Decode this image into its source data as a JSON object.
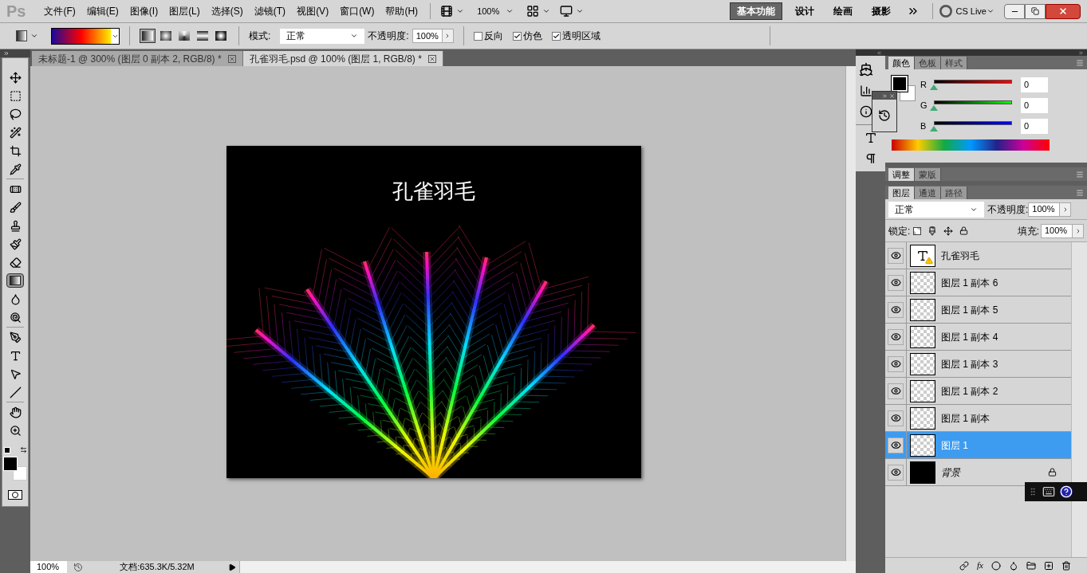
{
  "app_logo": "Ps",
  "menu": [
    "文件(F)",
    "编辑(E)",
    "图像(I)",
    "图层(L)",
    "选择(S)",
    "滤镜(T)",
    "视图(V)",
    "窗口(W)",
    "帮助(H)"
  ],
  "zoom_menu": "100%",
  "workspaces": [
    {
      "label": "基本功能",
      "selected": true
    },
    {
      "label": "设计",
      "selected": false
    },
    {
      "label": "绘画",
      "selected": false
    },
    {
      "label": "摄影",
      "selected": false
    }
  ],
  "cs_live": "CS Live",
  "options_bar": {
    "gradient_types": [
      {
        "kind": "linear",
        "selected": true
      },
      {
        "kind": "radial",
        "selected": false
      },
      {
        "kind": "angle",
        "selected": false
      },
      {
        "kind": "reflected",
        "selected": false
      },
      {
        "kind": "diamond",
        "selected": false
      }
    ],
    "mode_label": "模式:",
    "mode": "正常",
    "opacity_label": "不透明度:",
    "opacity": "100%",
    "checkboxes": [
      {
        "label": "反向",
        "checked": false
      },
      {
        "label": "仿色",
        "checked": true
      },
      {
        "label": "透明区域",
        "checked": true
      }
    ]
  },
  "document_tabs": [
    {
      "title": "未标题-1 @ 300% (图层 0 副本 2, RGB/8) *",
      "selected": false
    },
    {
      "title": "孔雀羽毛.psd @ 100% (图层 1, RGB/8) *",
      "selected": true
    }
  ],
  "tool_groups": [
    [
      {
        "kind": "move",
        "selected": false
      },
      {
        "kind": "marquee",
        "selected": false
      },
      {
        "kind": "lasso",
        "selected": false
      },
      {
        "kind": "quick-select",
        "selected": false
      },
      {
        "kind": "crop",
        "selected": false
      },
      {
        "kind": "eyedropper",
        "selected": false
      }
    ],
    [
      {
        "kind": "healing",
        "selected": false
      },
      {
        "kind": "brush",
        "selected": false
      },
      {
        "kind": "stamp",
        "selected": false
      },
      {
        "kind": "history-brush",
        "selected": false
      },
      {
        "kind": "eraser",
        "selected": false
      },
      {
        "kind": "gradient",
        "selected": true
      },
      {
        "kind": "blur",
        "selected": false
      },
      {
        "kind": "dodge",
        "selected": false
      }
    ],
    [
      {
        "kind": "pen",
        "selected": false
      },
      {
        "kind": "type",
        "selected": false
      },
      {
        "kind": "path-select",
        "selected": false
      },
      {
        "kind": "line",
        "selected": false
      }
    ],
    [
      {
        "kind": "hand",
        "selected": false
      },
      {
        "kind": "zoom",
        "selected": false
      }
    ]
  ],
  "canvas": {
    "title": "孔雀羽毛"
  },
  "color_panel": {
    "tabs": [
      {
        "label": "颜色",
        "selected": true
      },
      {
        "label": "色板",
        "selected": false
      },
      {
        "label": "样式",
        "selected": false
      }
    ],
    "channels": [
      {
        "label": "R",
        "value": "0",
        "level": 0
      },
      {
        "label": "G",
        "value": "0",
        "level": 0
      },
      {
        "label": "B",
        "value": "0",
        "level": 0
      }
    ]
  },
  "adjust_panel": {
    "tabs": [
      {
        "label": "调整",
        "selected": true
      },
      {
        "label": "蒙版",
        "selected": false
      }
    ]
  },
  "layers_panel": {
    "tabs": [
      {
        "label": "图层",
        "selected": true
      },
      {
        "label": "通道",
        "selected": false
      },
      {
        "label": "路径",
        "selected": false
      }
    ],
    "style_button": "fx",
    "blend_mode": "正常",
    "opacity_label": "不透明度:",
    "opacity": "100%",
    "lock_label": "锁定:",
    "fill_label": "填充:",
    "fill": "100%",
    "layers": [
      {
        "name": "孔雀羽毛",
        "kind": "text",
        "visible": true,
        "selected": false
      },
      {
        "name": "图层 1 副本 6",
        "kind": "pixel",
        "visible": true,
        "selected": false
      },
      {
        "name": "图层 1 副本 5",
        "kind": "pixel",
        "visible": true,
        "selected": false
      },
      {
        "name": "图层 1 副本 4",
        "kind": "pixel",
        "visible": true,
        "selected": false
      },
      {
        "name": "图层 1 副本 3",
        "kind": "pixel",
        "visible": true,
        "selected": false
      },
      {
        "name": "图层 1 副本 2",
        "kind": "pixel",
        "visible": true,
        "selected": false
      },
      {
        "name": "图层 1 副本",
        "kind": "pixel",
        "visible": true,
        "selected": false
      },
      {
        "name": "图层 1",
        "kind": "pixel",
        "visible": true,
        "selected": true
      },
      {
        "name": "背景",
        "kind": "background",
        "visible": true,
        "selected": false
      }
    ]
  },
  "status_bar": {
    "zoom": "100%",
    "doc_info": "文档:635.3K/5.32M"
  }
}
